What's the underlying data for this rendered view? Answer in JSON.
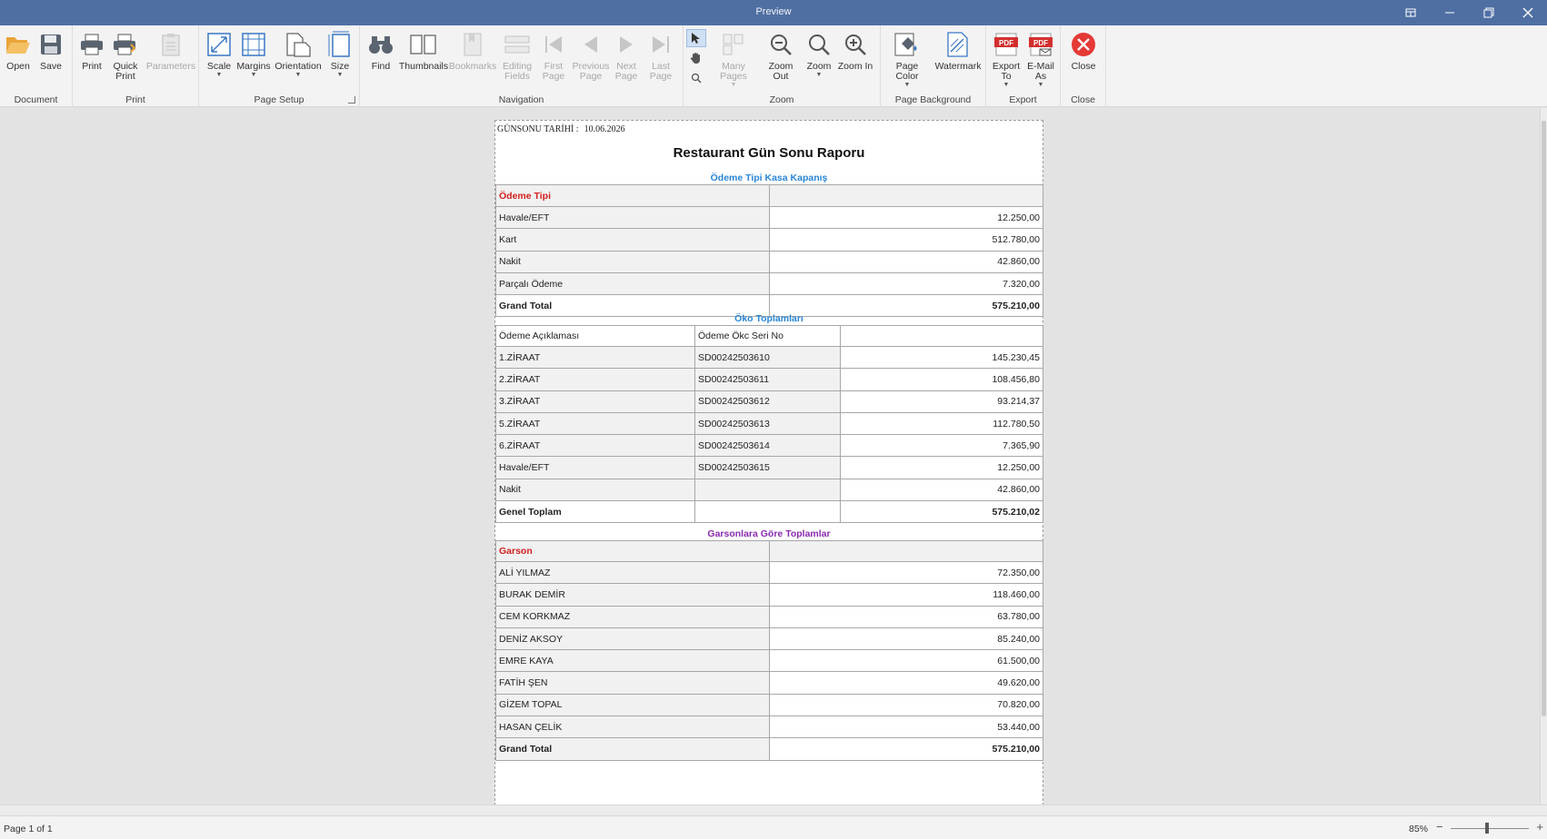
{
  "window": {
    "title": "Preview"
  },
  "ribbon": {
    "groups": {
      "document": "Document",
      "print": "Print",
      "page_setup": "Page Setup",
      "navigation": "Navigation",
      "zoom": "Zoom",
      "page_background": "Page Background",
      "export": "Export",
      "close": "Close"
    },
    "buttons": {
      "open": "Open",
      "save": "Save",
      "print": "Print",
      "quick_print_1": "Quick",
      "quick_print_2": "Print",
      "parameters": "Parameters",
      "scale": "Scale",
      "margins": "Margins",
      "orientation": "Orientation",
      "size": "Size",
      "find": "Find",
      "thumbnails": "Thumbnails",
      "bookmarks": "Bookmarks",
      "editing_fields_1": "Editing",
      "editing_fields_2": "Fields",
      "first_page_1": "First",
      "first_page_2": "Page",
      "previous_page_1": "Previous",
      "previous_page_2": "Page",
      "next_page_1": "Next",
      "next_page_2": "Page",
      "last_page_1": "Last",
      "last_page_2": "Page",
      "many_pages": "Many Pages",
      "zoom_out": "Zoom Out",
      "zoom": "Zoom",
      "zoom_in": "Zoom In",
      "page_color": "Page Color",
      "watermark": "Watermark",
      "export_to_1": "Export",
      "export_to_2": "To",
      "email_as_1": "E-Mail",
      "email_as_2": "As",
      "close": "Close",
      "pdf": "PDF"
    }
  },
  "report": {
    "date_label": "GÜNSONU TARİHİ :",
    "date_value": "10.06.2026",
    "title": "Restaurant Gün Sonu Raporu",
    "payment_section": {
      "title": "Ödeme Tipi Kasa Kapanış",
      "header": "Ödeme Tipi",
      "rows": [
        {
          "label": "Havale/EFT",
          "value": "12.250,00"
        },
        {
          "label": "Kart",
          "value": "512.780,00"
        },
        {
          "label": "Nakit",
          "value": "42.860,00"
        },
        {
          "label": "Parçalı Ödeme",
          "value": "7.320,00"
        }
      ],
      "total_label": "Grand Total",
      "total_value": "575.210,00"
    },
    "oko_section": {
      "title": "Öko Toplamları",
      "col1": "Ödeme Açıklaması",
      "col2": "Ödeme Ökc Seri No",
      "rows": [
        {
          "desc": "1.ZİRAAT",
          "serial": "SD00242503610",
          "value": "145.230,45"
        },
        {
          "desc": "2.ZİRAAT",
          "serial": "SD00242503611",
          "value": "108.456,80"
        },
        {
          "desc": "3.ZİRAAT",
          "serial": "SD00242503612",
          "value": "93.214,37"
        },
        {
          "desc": "5.ZİRAAT",
          "serial": "SD00242503613",
          "value": "112.780,50"
        },
        {
          "desc": "6.ZİRAAT",
          "serial": "SD00242503614",
          "value": "7.365,90"
        },
        {
          "desc": "Havale/EFT",
          "serial": "SD00242503615",
          "value": "12.250,00"
        },
        {
          "desc": "Nakit",
          "serial": "",
          "value": "42.860,00"
        }
      ],
      "total_label": "Genel Toplam",
      "total_value": "575.210,02"
    },
    "waiter_section": {
      "title": "Garsonlara Göre Toplamlar",
      "header": "Garson",
      "rows": [
        {
          "name": "ALİ YILMAZ",
          "value": "72.350,00"
        },
        {
          "name": "BURAK DEMİR",
          "value": "118.460,00"
        },
        {
          "name": "CEM KORKMAZ",
          "value": "63.780,00"
        },
        {
          "name": "DENİZ AKSOY",
          "value": "85.240,00"
        },
        {
          "name": "EMRE KAYA",
          "value": "61.500,00"
        },
        {
          "name": "FATİH ŞEN",
          "value": "49.620,00"
        },
        {
          "name": "GİZEM TOPAL",
          "value": "70.820,00"
        },
        {
          "name": "HASAN ÇELİK",
          "value": "53.440,00"
        }
      ],
      "total_label": "Grand Total",
      "total_value": "575.210,00"
    }
  },
  "status": {
    "page_info": "Page 1 of 1",
    "zoom": "85%",
    "zoom_level": 0.85
  },
  "colors": {
    "titlebar": "#4f6fa3",
    "accent_blue": "#2a86d6",
    "accent_red": "#d42020",
    "accent_purple": "#8a2ab0"
  }
}
